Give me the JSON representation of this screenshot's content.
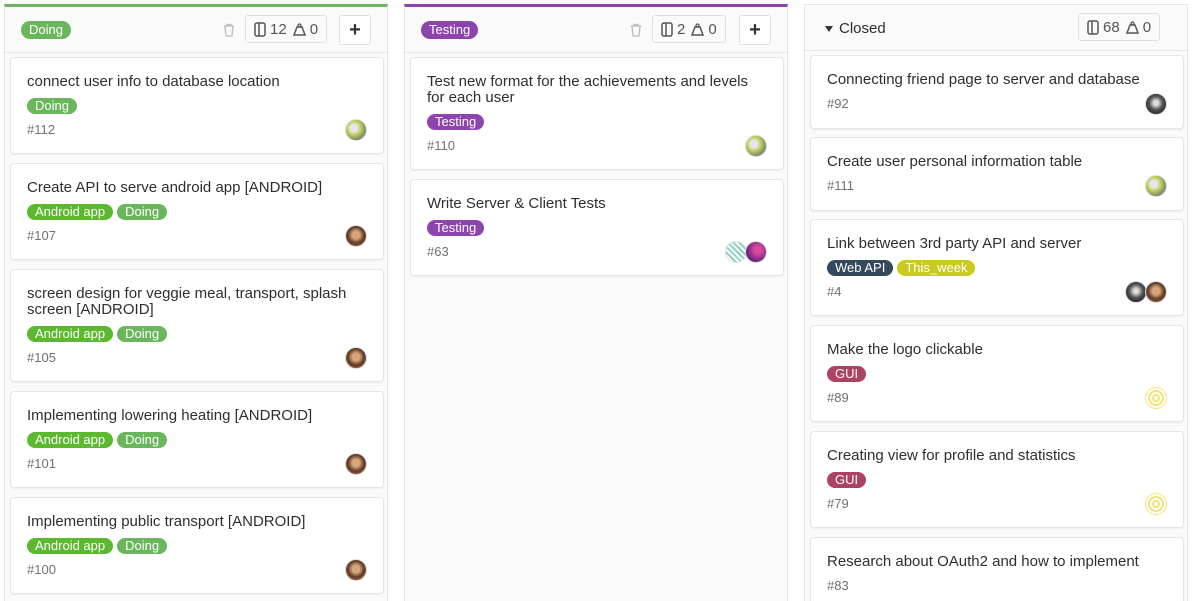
{
  "columns": {
    "doing": {
      "label": "Doing",
      "color": "#69b65c",
      "issue_count": "12",
      "weight": "0",
      "cards": [
        {
          "title": "connect user info to database location",
          "labels": [
            "Doing"
          ],
          "number": "#112",
          "avatars": [
            "green-gray-avatar"
          ]
        },
        {
          "title": "Create API to serve android app [ANDROID]",
          "labels": [
            "Android app",
            "Doing"
          ],
          "number": "#107",
          "avatars": [
            "person-avatar"
          ]
        },
        {
          "title": "screen design for veggie meal, transport, splash screen [ANDROID]",
          "labels": [
            "Android app",
            "Doing"
          ],
          "number": "#105",
          "avatars": [
            "person-avatar"
          ]
        },
        {
          "title": "Implementing lowering heating [ANDROID]",
          "labels": [
            "Android app",
            "Doing"
          ],
          "number": "#101",
          "avatars": [
            "person-avatar"
          ]
        },
        {
          "title": "Implementing public transport [ANDROID]",
          "labels": [
            "Android app",
            "Doing"
          ],
          "number": "#100",
          "avatars": [
            "person-avatar"
          ]
        }
      ]
    },
    "testing": {
      "label": "Testing",
      "color": "#8e44ad",
      "issue_count": "2",
      "weight": "0",
      "cards": [
        {
          "title": "Test new format for the achievements and levels for each user",
          "labels": [
            "Testing"
          ],
          "number": "#110",
          "avatars": [
            "green-gray-avatar"
          ]
        },
        {
          "title": "Write Server & Client Tests",
          "labels": [
            "Testing"
          ],
          "number": "#63",
          "avatars": [
            "pattern-avatar",
            "purple-avatar"
          ]
        }
      ]
    },
    "closed": {
      "label": "Closed",
      "issue_count": "68",
      "weight": "0",
      "cards": [
        {
          "title": "Connecting friend page to server and database",
          "labels": [],
          "number": "#92",
          "avatars": [
            "dark-avatar"
          ]
        },
        {
          "title": "Create user personal information table",
          "labels": [],
          "number": "#111",
          "avatars": [
            "green-gray-avatar"
          ]
        },
        {
          "title": "Link between 3rd party API and server",
          "labels": [
            "Web API",
            "This_week"
          ],
          "number": "#4",
          "avatars": [
            "dark-avatar",
            "person-avatar"
          ]
        },
        {
          "title": "Make the logo clickable",
          "labels": [
            "GUI"
          ],
          "number": "#89",
          "avatars": [
            "yellow-pattern-avatar"
          ]
        },
        {
          "title": "Creating view for profile and statistics",
          "labels": [
            "GUI"
          ],
          "number": "#79",
          "avatars": [
            "yellow-pattern-avatar"
          ]
        },
        {
          "title": "Research about OAuth2 and how to implement",
          "labels": [],
          "number": "#83",
          "avatars": []
        }
      ]
    }
  },
  "label_colors": {
    "Doing": "#69b65c",
    "Testing": "#8e44ad",
    "Android app": "#5cb82f",
    "Web API": "#34495e",
    "This_week": "#c9c91e",
    "GUI": "#ad4363"
  },
  "icons": {
    "trash": "trash-icon",
    "issues": "issues-icon",
    "weight": "weight-icon",
    "add": "+"
  }
}
